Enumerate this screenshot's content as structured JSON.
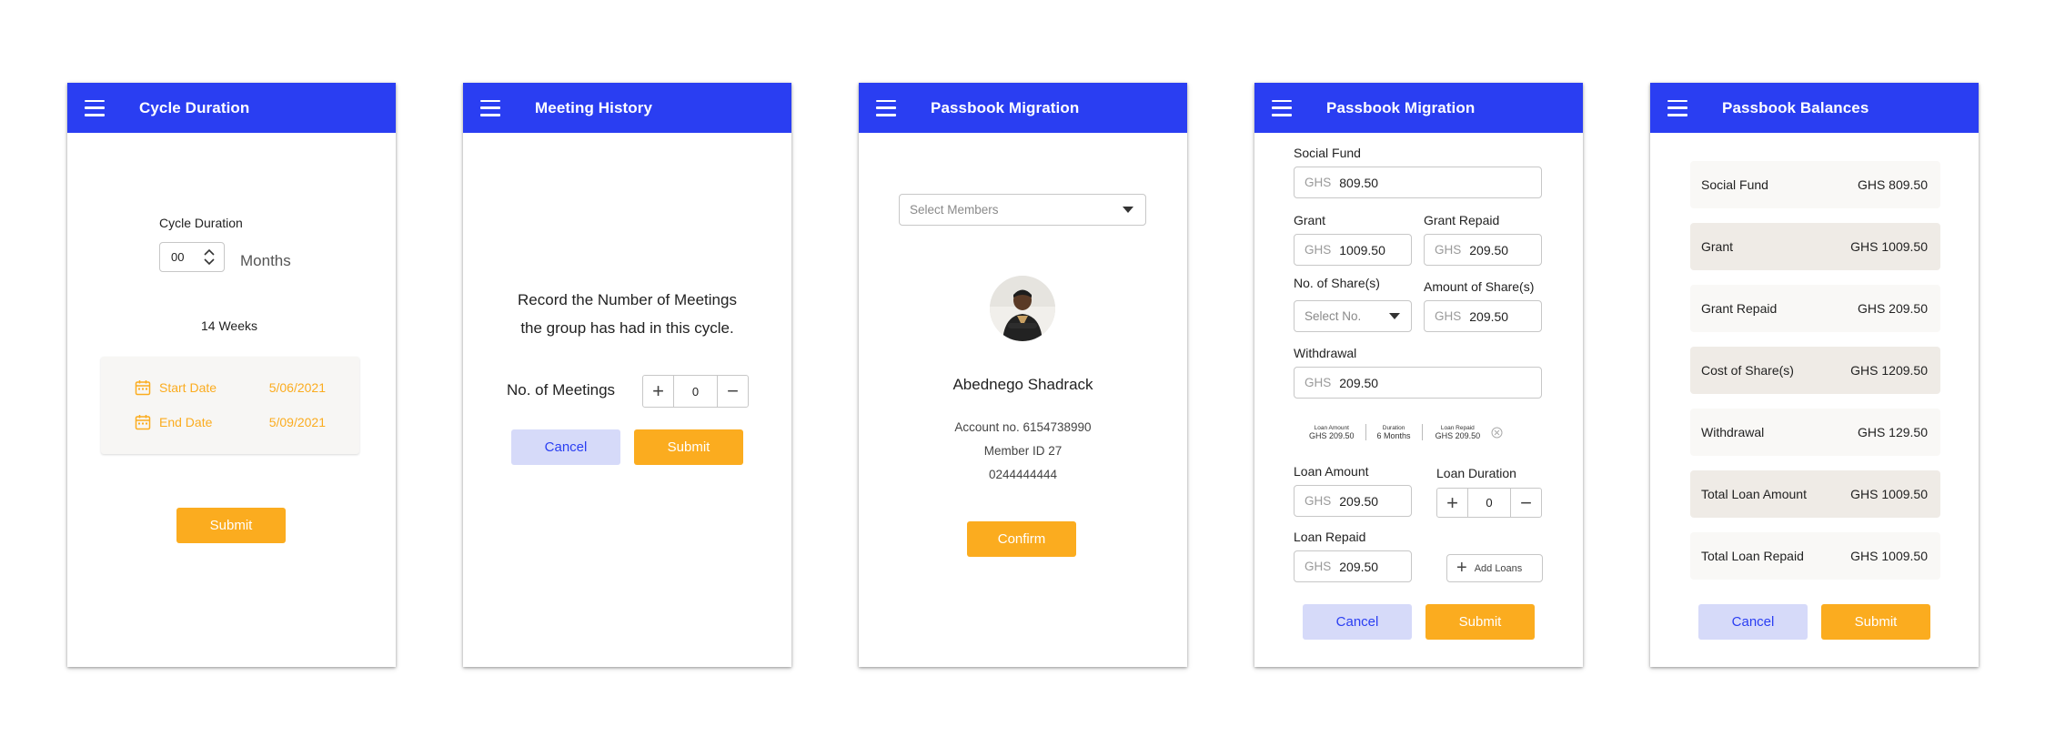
{
  "screens": {
    "cycle": {
      "title": "Cycle Duration",
      "field_label": "Cycle Duration",
      "value": "00",
      "unit": "Months",
      "weeks": "14 Weeks",
      "start_label": "Start Date",
      "start_value": "5/06/2021",
      "end_label": "End Date",
      "end_value": "5/09/2021",
      "submit": "Submit"
    },
    "meeting": {
      "title": "Meeting History",
      "prompt_line1": "Record the Number of Meetings",
      "prompt_line2": "the group has had in this cycle.",
      "meetings_label": "No. of Meetings",
      "meetings_value": "0",
      "cancel": "Cancel",
      "submit": "Submit"
    },
    "migration1": {
      "title": "Passbook Migration",
      "select_placeholder": "Select Members",
      "member_name": "Abednego Shadrack",
      "account": "Account no. 6154738990",
      "member_id": "Member ID 27",
      "phone": "0244444444",
      "confirm": "Confirm"
    },
    "migration2": {
      "title": "Passbook Migration",
      "currency": "GHS",
      "social_fund_label": "Social Fund",
      "social_fund": "809.50",
      "grant_label": "Grant",
      "grant": "1009.50",
      "grant_repaid_label": "Grant Repaid",
      "grant_repaid": "209.50",
      "shares_label": "No. of Share(s)",
      "shares_placeholder": "Select No.",
      "amount_shares_label": "Amount of Share(s)",
      "amount_shares": "209.50",
      "withdrawal_label": "Withdrawal",
      "withdrawal": "209.50",
      "summary": [
        {
          "label": "Loan Amount",
          "value": "GHS 209.50"
        },
        {
          "label": "Duration",
          "value": "6 Months"
        },
        {
          "label": "Loan Repaid",
          "value": "GHS 209.50"
        }
      ],
      "loan_amount_label": "Loan Amount",
      "loan_amount": "209.50",
      "loan_duration_label": "Loan Duration",
      "loan_duration": "0",
      "loan_repaid_label": "Loan Repaid",
      "loan_repaid": "209.50",
      "add_loans": "Add Loans",
      "cancel": "Cancel",
      "submit": "Submit"
    },
    "balances": {
      "title": "Passbook Balances",
      "rows": [
        {
          "label": "Social Fund",
          "value": "GHS 809.50"
        },
        {
          "label": "Grant",
          "value": "GHS 1009.50"
        },
        {
          "label": "Grant Repaid",
          "value": "GHS 209.50"
        },
        {
          "label": "Cost of Share(s)",
          "value": "GHS 1209.50"
        },
        {
          "label": "Withdrawal",
          "value": "GHS 129.50"
        },
        {
          "label": "Total Loan Amount",
          "value": "GHS 1009.50"
        },
        {
          "label": "Total Loan Repaid",
          "value": "GHS 1009.50"
        }
      ],
      "cancel": "Cancel",
      "submit": "Submit"
    }
  },
  "colors": {
    "appbar": "#2a3ef2",
    "primary_button": "#fbac1f",
    "cancel_button": "#d6daf9",
    "date_accent": "#fbac1f"
  }
}
